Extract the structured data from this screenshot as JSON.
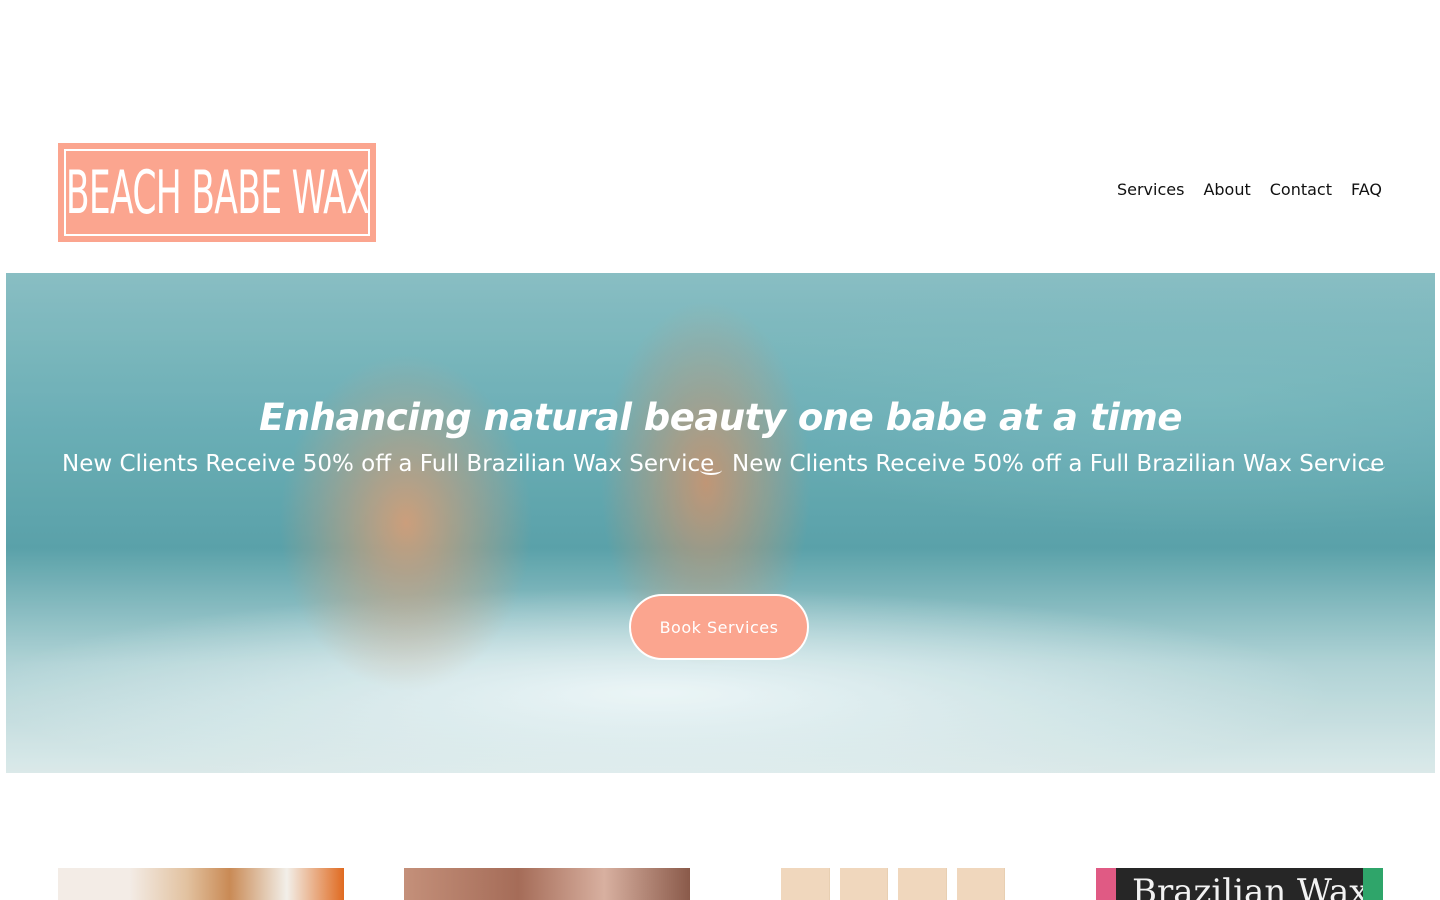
{
  "brand": {
    "logo_text": "Beach Babe Wax"
  },
  "nav": [
    {
      "label": "Services"
    },
    {
      "label": "About"
    },
    {
      "label": "Contact"
    },
    {
      "label": "FAQ"
    }
  ],
  "hero": {
    "heading": "Enhancing natural beauty one babe at a time",
    "announcement": "New Clients Receive 50% off a Full Brazilian Wax Service",
    "cta_label": "Book Services"
  },
  "tiles": {
    "brazilian_label": "Brazilian Wax"
  },
  "colors": {
    "accent": "#fba58f"
  }
}
